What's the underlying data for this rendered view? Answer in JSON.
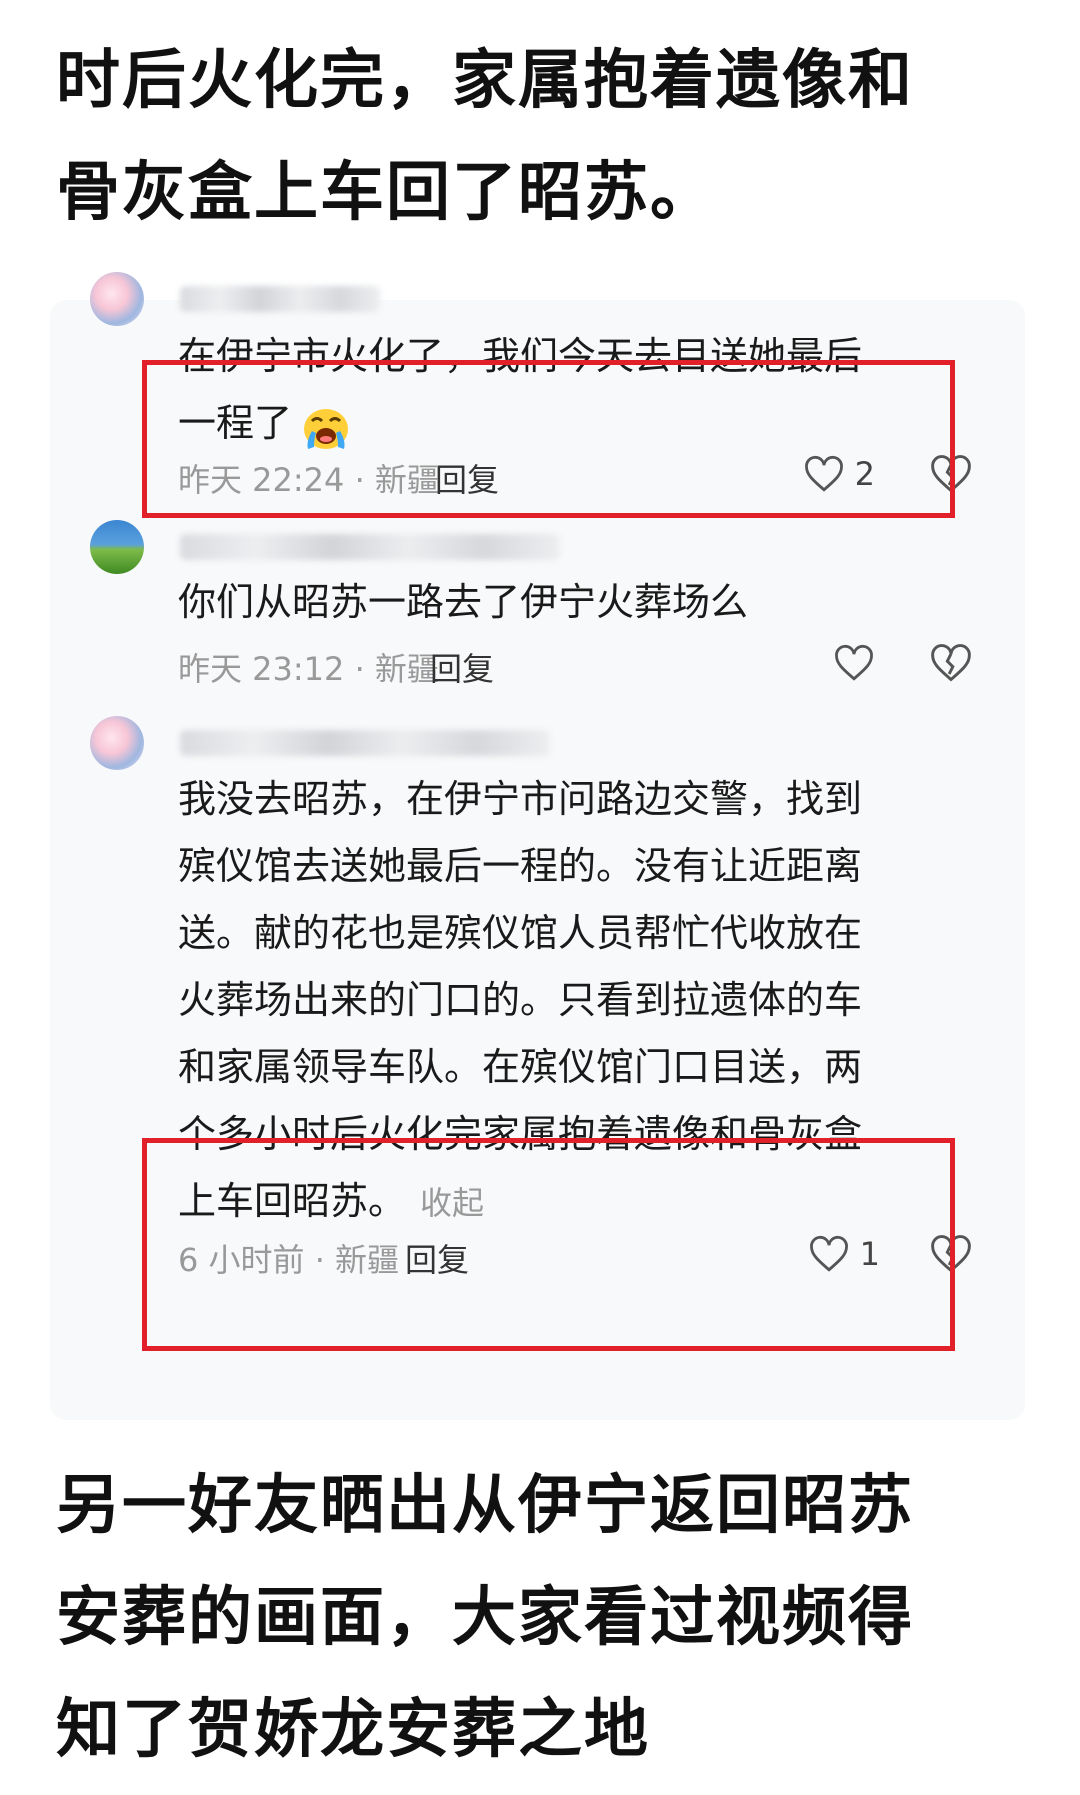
{
  "article": {
    "top_lines": [
      "时后火化完，家属抱着遗像和",
      "骨灰盒上车回了昭苏。"
    ],
    "bottom_lines": [
      "另一好友晒出从伊宁返回昭苏",
      "安葬的画面，大家看过视频得",
      "知了贺娇龙安葬之地"
    ]
  },
  "comments": [
    {
      "avatar": "opera-mask-avatar",
      "text_lines": [
        "在伊宁市火化了，我们今天去目送她最后",
        "一程了"
      ],
      "emoji": "crying-face-emoji",
      "meta": "昨天 22:24 · 新疆",
      "reply_label": "回复",
      "likes": "2",
      "highlighted": true
    },
    {
      "avatar": "grassland-avatar",
      "text_lines": [
        "你们从昭苏一路去了伊宁火葬场么"
      ],
      "meta": "昨天 23:12 · 新疆",
      "reply_label": "回复",
      "likes": "",
      "highlighted": false
    },
    {
      "avatar": "opera-mask-avatar",
      "text_lines": [
        "我没去昭苏，在伊宁市问路边交警，找到",
        "殡仪馆去送她最后一程的。没有让近距离",
        "送。献的花也是殡仪馆人员帮忙代收放在",
        "火葬场出来的门口的。只看到拉遗体的车",
        "和家属领导车队。在殡仪馆门口目送，两",
        "个多小时后火化完家属抱着遗像和骨灰盒",
        "上车回昭苏。"
      ],
      "collapse_label": "收起",
      "meta": "6 小时前 · 新疆",
      "reply_label": "回复",
      "likes": "1",
      "highlighted": true
    }
  ],
  "colors": {
    "highlight": "#e2202a",
    "meta": "#999999",
    "card_bg": "#f8f9fa"
  }
}
